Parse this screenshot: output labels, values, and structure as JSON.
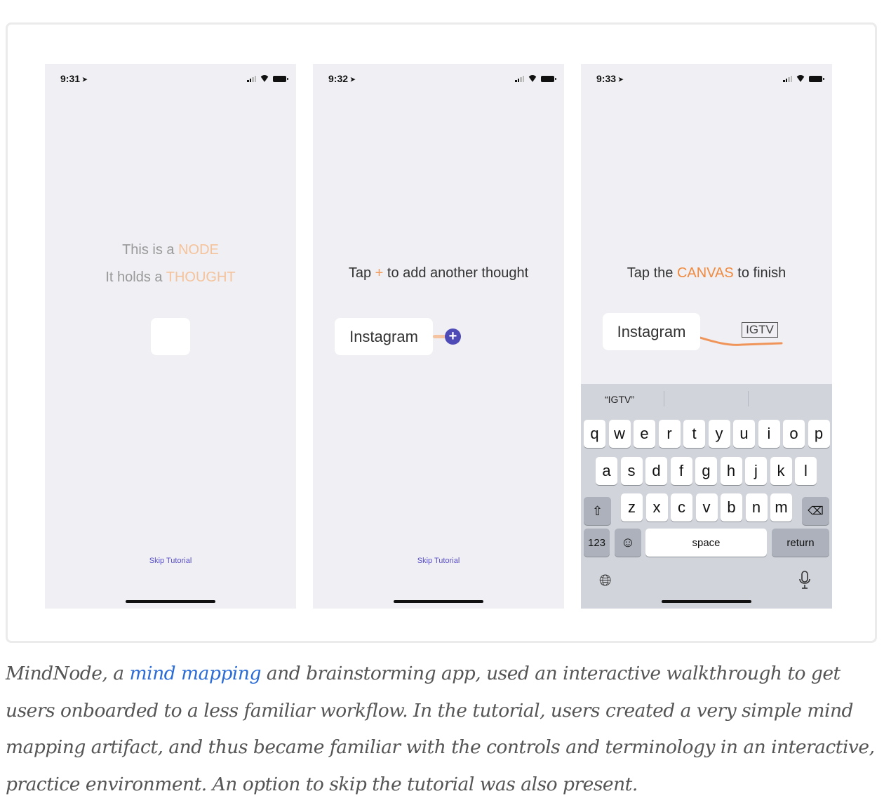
{
  "screens": [
    {
      "time": "9:31",
      "line1_prefix": "This is a ",
      "line1_highlight": "NODE",
      "line2_prefix": "It holds a ",
      "line2_highlight": "THOUGHT",
      "skip_label": "Skip Tutorial"
    },
    {
      "time": "9:32",
      "instruction_prefix": "Tap ",
      "instruction_plus": "+",
      "instruction_suffix": " to add another thought",
      "node_text": "Instagram",
      "add_button": "+",
      "skip_label": "Skip Tutorial"
    },
    {
      "time": "9:33",
      "instruction_prefix": "Tap the ",
      "instruction_highlight": "CANVAS",
      "instruction_suffix": " to finish",
      "node_text": "Instagram",
      "child_node_text": "IGTV",
      "keyboard": {
        "prediction": "“IGTV”",
        "row1": [
          "q",
          "w",
          "e",
          "r",
          "t",
          "y",
          "u",
          "i",
          "o",
          "p"
        ],
        "row2": [
          "a",
          "s",
          "d",
          "f",
          "g",
          "h",
          "j",
          "k",
          "l"
        ],
        "row3": [
          "z",
          "x",
          "c",
          "v",
          "b",
          "n",
          "m"
        ],
        "numbers_key": "123",
        "space_key": "space",
        "return_key": "return"
      }
    }
  ],
  "caption": {
    "before_link": "MindNode, a ",
    "link_text": "mind mapping",
    "after_link": " and brainstorming app, used an interactive walkthrough to get users onboarded to a less familiar workflow. In the tutorial, users created a very simple mind mapping artifact, and thus became familiar with the controls and terminology in an interactive, practice environment. An option to skip the tutorial was also present."
  },
  "colors": {
    "accent_light": "#f5c39b",
    "accent_orange": "#f08a3e",
    "plus_button": "#4e4ab6",
    "link": "#2a6bd6"
  }
}
